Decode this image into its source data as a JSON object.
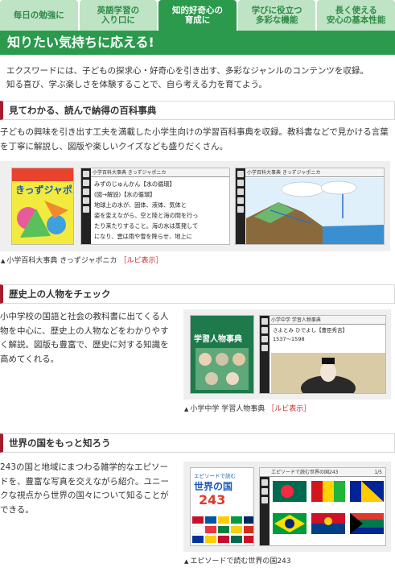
{
  "tabs": [
    {
      "label": "毎日の勉強に",
      "active": false
    },
    {
      "label": "英語学習の\n入り口に",
      "active": false
    },
    {
      "label": "知的好奇心の\n育成に",
      "active": true
    },
    {
      "label": "学びに役立つ\n多彩な機能",
      "active": false
    },
    {
      "label": "長く使える\n安心の基本性能",
      "active": false
    }
  ],
  "banner": {
    "title": "知りたい気持ちに応える!"
  },
  "intro": {
    "line1": "エクスワードには、子どもの探求心・好奇心を引き出す、多彩なジャンルのコンテンツを収録。",
    "line2": "知る喜び、学ぶ楽しさを体験することで、自ら考える力を育てよう。"
  },
  "sections": [
    {
      "heading": "見てわかる、読んで納得の百科事典",
      "body": "子どもの興味を引き出す工夫を満載した小学生向けの学習百科事典を収録。教科書などで見かける言葉を丁寧に解説し、図版や楽しいクイズなども盛りだくさん。",
      "caption": "小学百科大事典 きっずジャポニカ",
      "ruby": "［ルビ表示］",
      "book_title": "きっずジャポニカ",
      "screen1_header": "小学百科大事典 きっずジャポニカ",
      "screen1_lines": [
        "みずのじゅんかん【水の循環】",
        "(図→解説)【水の循環】",
        "地球上の水が、固体、液体、気体と",
        "姿を変えながら、空と陸と海の間を行っ",
        "たり来たりすること。海の水は蒸発して",
        "になり、雲は雨や雪を降らせ、地上に"
      ],
      "screen2_header": "小学百科大事典 きっずジャポニカ"
    },
    {
      "heading": "歴史上の人物をチェック",
      "body": "小中学校の国語と社会の教科書に出てくる人物を中心に、歴史上の人物などをわかりやすく解説。図版も豊富で、歴史に対する知識を高めてくれる。",
      "caption": "小学中学 学習人物事典",
      "ruby": "［ルビ表示］",
      "book_title": "学習人物事典",
      "screen_header": "小学中学 学習人物事典",
      "screen_lines": [
        "さよとみ ひでよし【豊臣秀吉】",
        "1537〜1598"
      ]
    },
    {
      "heading": "世界の国をもっと知ろう",
      "body": "243の国と地域にまつわる雑学的なエピソードを、豊富な写真を交えながら紹介。ユニークな視点から世界の国々について知ることができる。",
      "caption": "エピソードで読む世界の国243",
      "book_title_top": "エピソードで読む",
      "book_title": "世界の国",
      "book_number": "243",
      "screen_header": "エピソードで読む世界の国243",
      "screen_page": "1/5"
    }
  ],
  "colors": {
    "accent_green": "#2b9a4d",
    "tab_light": "#bfe3c5",
    "section_bar": "#a51d2d",
    "ruby_red": "#d0262a"
  }
}
